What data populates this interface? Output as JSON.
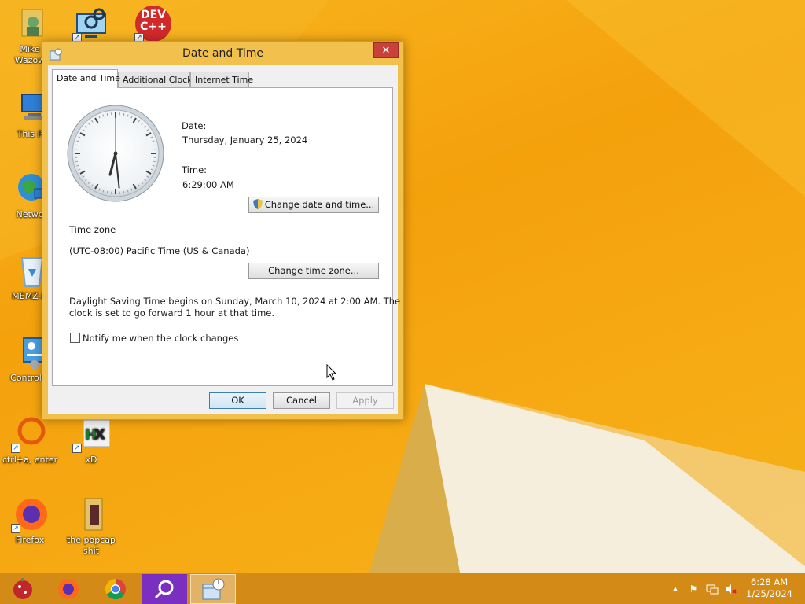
{
  "desktop": {
    "icons": [
      {
        "label": "Mike\nWazow",
        "icon": "user-folder-icon"
      },
      {
        "label": "",
        "icon": "settings-computer-icon"
      },
      {
        "label": "",
        "icon": "dev-cpp-icon"
      },
      {
        "label": "This P",
        "icon": "this-pc-icon"
      },
      {
        "label": "Netwo",
        "icon": "network-icon"
      },
      {
        "label": "MEMZ-D",
        "icon": "recycle-bin-icon"
      },
      {
        "label": "Control P",
        "icon": "control-panel-icon"
      },
      {
        "label": "ctrl+a, enter",
        "icon": "ring-shortcut-icon"
      },
      {
        "label": "xD",
        "icon": "hxd-icon"
      },
      {
        "label": "Firefox",
        "icon": "firefox-icon"
      },
      {
        "label": "the popcap\nshit",
        "icon": "folder-icon"
      }
    ],
    "dev_badge": "DEV\nC++"
  },
  "dialog": {
    "title": "Date and Time",
    "close_glyph": "✕",
    "tabs": [
      "Date and Time",
      "Additional Clocks",
      "Internet Time"
    ],
    "date_label": "Date:",
    "date_value": "Thursday, January 25, 2024",
    "time_label": "Time:",
    "time_value": "6:29:00 AM",
    "change_datetime_button": "Change date and time...",
    "timezone_header": "Time zone",
    "timezone_value": "(UTC-08:00) Pacific Time (US & Canada)",
    "change_timezone_button": "Change time zone...",
    "dst_line1": "Daylight Saving Time begins on Sunday, March 10, 2024 at 2:00 AM. The",
    "dst_line2": "clock is set to go forward 1 hour at that time.",
    "notify_label": "Notify me when the clock changes",
    "notify_checked": false,
    "ok": "OK",
    "cancel": "Cancel",
    "apply": "Apply",
    "clock_face": {
      "hour": 6,
      "minute": 29,
      "second": 0
    }
  },
  "taskbar": {
    "apps": [
      "ornament-app-icon",
      "firefox-taskbar-icon",
      "chrome-taskbar-icon",
      "magnifier-taskbar-icon",
      "datetime-taskbar-icon"
    ],
    "tray": {
      "expand": "▲",
      "flag": "⚑"
    },
    "time": "6:28 AM",
    "date": "1/25/2024"
  },
  "colors": {
    "accent": "#f4a10c",
    "taskbar": "#d38a16",
    "close": "#c7423a"
  }
}
